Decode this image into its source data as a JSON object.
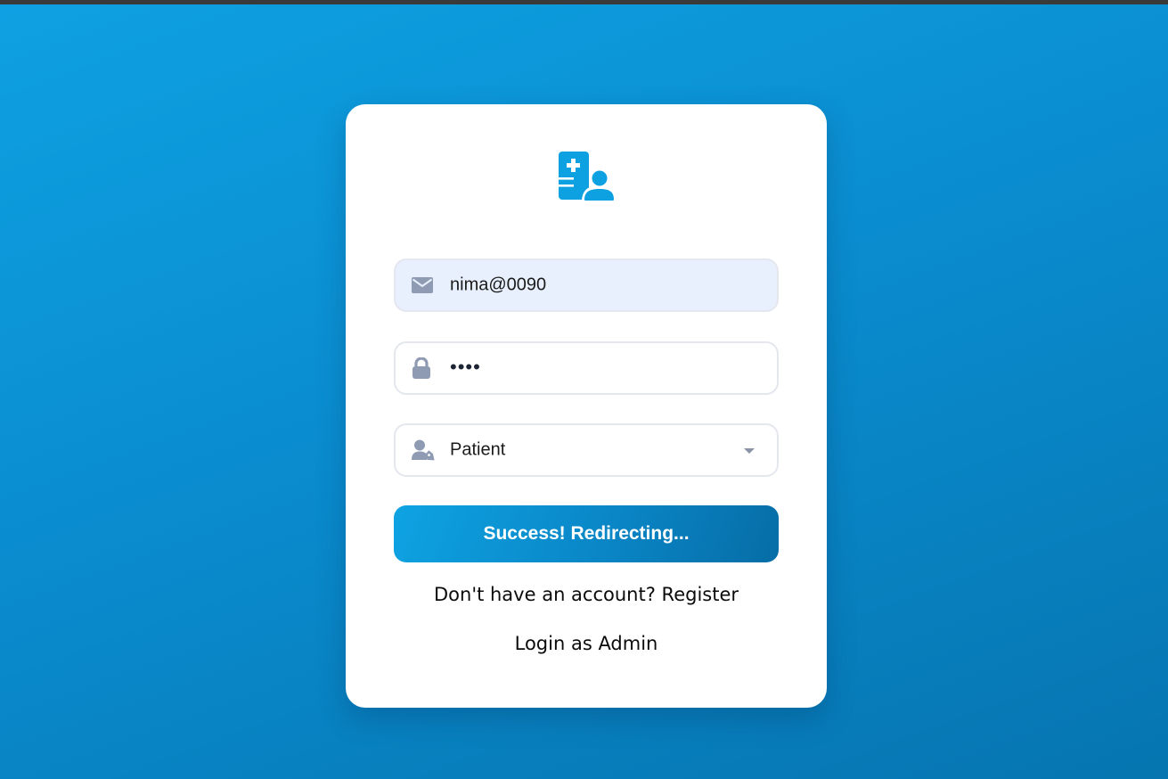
{
  "app": {
    "logo_icon": "medical-record-user-icon",
    "accent_color": "#0ea1e2"
  },
  "login_form": {
    "email": {
      "icon": "envelope-icon",
      "value": "nima@0090"
    },
    "password": {
      "icon": "lock-icon",
      "masked_value": "••••"
    },
    "role": {
      "icon": "user-tag-icon",
      "selected": "Patient"
    },
    "submit_label": "Success! Redirecting...",
    "register_prompt": "Don't have an account?",
    "register_link": "Register",
    "admin_link": "Login as Admin"
  }
}
